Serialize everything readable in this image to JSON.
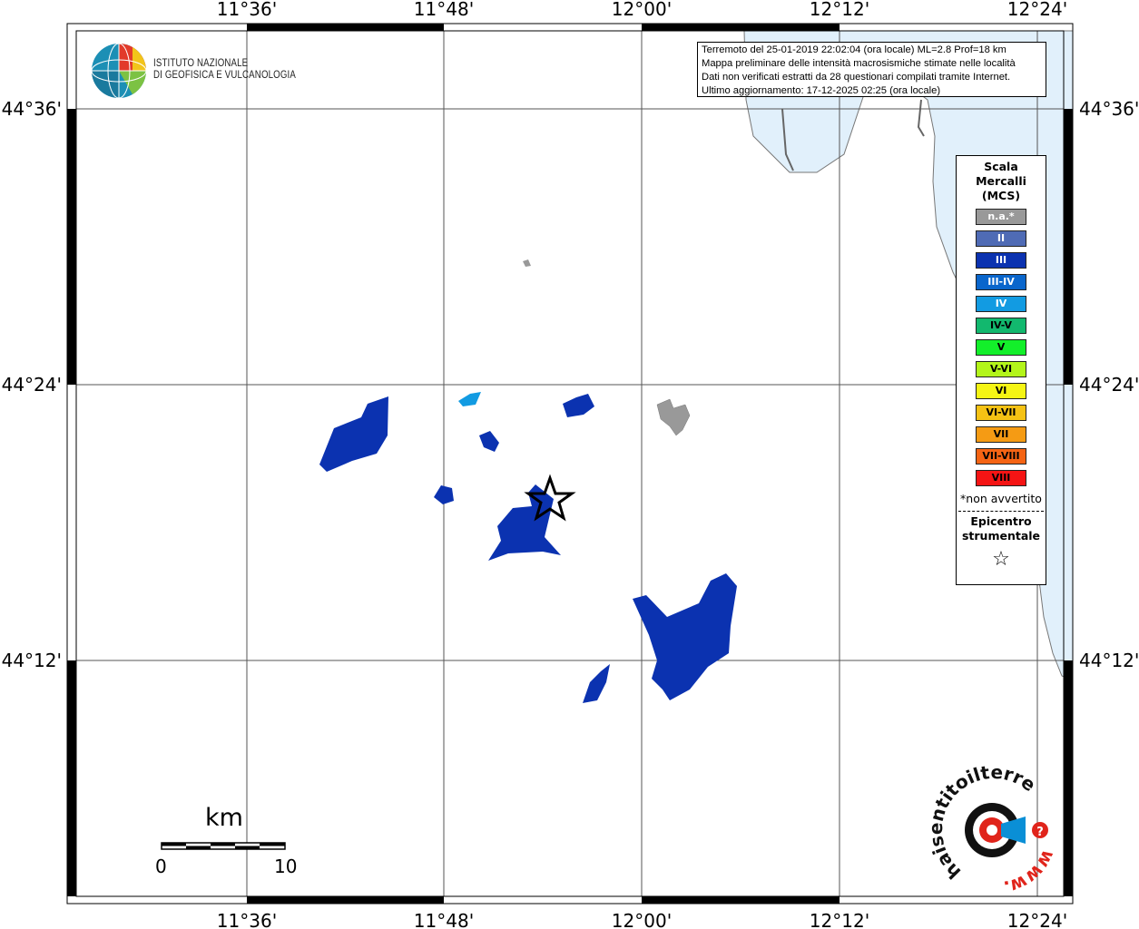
{
  "info": {
    "line1": "Terremoto del 25-01-2019 22:02:04 (ora locale) ML=2.8 Prof=18 km",
    "line2": "Mappa preliminare delle intensità macrosismiche stimate nelle località",
    "line3": "Dati non verificati estratti da 28 questionari compilati tramite Internet.",
    "line4": "Ultimo aggiornamento: 17-12-2025 02:25 (ora locale)"
  },
  "institute": {
    "line1": "ISTITUTO NAZIONALE",
    "line2": "DI GEOFISICA E VULCANOLOGIA"
  },
  "axes": {
    "longitude_ticks": [
      "11°36'",
      "11°48'",
      "12°00'",
      "12°12'",
      "12°24'"
    ],
    "latitude_ticks": [
      "44°36'",
      "44°24'",
      "44°12'"
    ]
  },
  "legend": {
    "title_line1": "Scala",
    "title_line2": "Mercalli",
    "title_line3": "(MCS)",
    "items": [
      {
        "label": "n.a.*",
        "color": "#999999",
        "text_color": "#ffffff"
      },
      {
        "label": "II",
        "color": "#4f6bb5",
        "text_color": "#ffffff"
      },
      {
        "label": "III",
        "color": "#0b32b0",
        "text_color": "#ffffff"
      },
      {
        "label": "III-IV",
        "color": "#0a66cc",
        "text_color": "#ffffff"
      },
      {
        "label": "IV",
        "color": "#129be2",
        "text_color": "#ffffff"
      },
      {
        "label": "IV-V",
        "color": "#12b86e",
        "text_color": "#000000"
      },
      {
        "label": "V",
        "color": "#13ef2a",
        "text_color": "#000000"
      },
      {
        "label": "V-VI",
        "color": "#b3f51a",
        "text_color": "#000000"
      },
      {
        "label": "VI",
        "color": "#f5f514",
        "text_color": "#000000"
      },
      {
        "label": "VI-VII",
        "color": "#f5c214",
        "text_color": "#000000"
      },
      {
        "label": "VII",
        "color": "#f59b14",
        "text_color": "#000000"
      },
      {
        "label": "VII-VIII",
        "color": "#f56414",
        "text_color": "#000000"
      },
      {
        "label": "VIII",
        "color": "#f51414",
        "text_color": "#000000"
      }
    ],
    "note": "*non avvertito",
    "epicenter_line1": "Epicentro",
    "epicenter_line2": "strumentale"
  },
  "scale_bar": {
    "unit": "km",
    "min": "0",
    "max": "10"
  },
  "hsit_logo": {
    "text": "haisentitoilterremoto.it",
    "www": "www."
  },
  "colors": {
    "sea": "#e1f0fb",
    "intensity_III": "#0b32b0",
    "intensity_IV": "#129be2",
    "not_felt": "#999999"
  }
}
